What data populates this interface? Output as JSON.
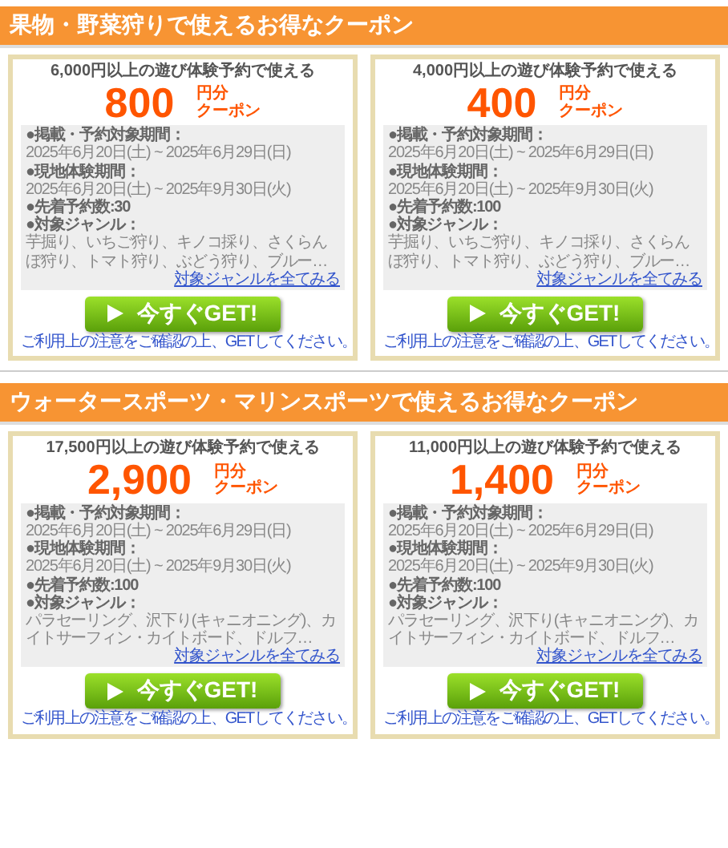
{
  "sections": [
    {
      "title": "果物・野菜狩りで使えるお得なクーポン",
      "coupons": [
        {
          "condition": "6,000円以上の遊び体験予約で使える",
          "amount": "800",
          "unit": [
            "円分",
            "クーポン"
          ],
          "details": [
            {
              "kind": "heading",
              "text": "●掲載・予約対象期間："
            },
            {
              "kind": "text",
              "text": "2025年6月20日(土) ~ 2025年6月29日(日)"
            },
            {
              "kind": "heading",
              "text": "●現地体験期間："
            },
            {
              "kind": "text",
              "text": "2025年6月20日(土) ~ 2025年9月30日(火)"
            },
            {
              "kind": "heading",
              "text": "●先着予約数:30"
            },
            {
              "kind": "heading",
              "text": "●対象ジャンル："
            },
            {
              "kind": "text",
              "text": "芋掘り、いちご狩り、キノコ採り、さくらんぼ狩り、トマト狩り、ぶどう狩り、ブルー…"
            }
          ],
          "link": "対象ジャンルを全てみる",
          "button": "今すぐGET!",
          "note": "ご利用上の注意をご確認の上、GETしてください。"
        },
        {
          "condition": "4,000円以上の遊び体験予約で使える",
          "amount": "400",
          "unit": [
            "円分",
            "クーポン"
          ],
          "details": [
            {
              "kind": "heading",
              "text": "●掲載・予約対象期間："
            },
            {
              "kind": "text",
              "text": "2025年6月20日(土) ~ 2025年6月29日(日)"
            },
            {
              "kind": "heading",
              "text": "●現地体験期間："
            },
            {
              "kind": "text",
              "text": "2025年6月20日(土) ~ 2025年9月30日(火)"
            },
            {
              "kind": "heading",
              "text": "●先着予約数:100"
            },
            {
              "kind": "heading",
              "text": "●対象ジャンル："
            },
            {
              "kind": "text",
              "text": "芋掘り、いちご狩り、キノコ採り、さくらんぼ狩り、トマト狩り、ぶどう狩り、ブルー…"
            }
          ],
          "link": "対象ジャンルを全てみる",
          "button": "今すぐGET!",
          "note": "ご利用上の注意をご確認の上、GETしてください。"
        }
      ]
    },
    {
      "title": "ウォータースポーツ・マリンスポーツで使えるお得なクーポン",
      "coupons": [
        {
          "condition": "17,500円以上の遊び体験予約で使える",
          "amount": "2,900",
          "unit": [
            "円分",
            "クーポン"
          ],
          "details": [
            {
              "kind": "heading",
              "text": "●掲載・予約対象期間："
            },
            {
              "kind": "text",
              "text": "2025年6月20日(土) ~ 2025年6月29日(日)"
            },
            {
              "kind": "heading",
              "text": "●現地体験期間："
            },
            {
              "kind": "text",
              "text": "2025年6月20日(土) ~ 2025年9月30日(火)"
            },
            {
              "kind": "heading",
              "text": "●先着予約数:100"
            },
            {
              "kind": "heading",
              "text": "●対象ジャンル："
            },
            {
              "kind": "text",
              "text": "パラセーリング、沢下り(キャニオニング)、カイトサーフィン・カイトボード、ドルフ…"
            }
          ],
          "link": "対象ジャンルを全てみる",
          "button": "今すぐGET!",
          "note": "ご利用上の注意をご確認の上、GETしてください。"
        },
        {
          "condition": "11,000円以上の遊び体験予約で使える",
          "amount": "1,400",
          "unit": [
            "円分",
            "クーポン"
          ],
          "details": [
            {
              "kind": "heading",
              "text": "●掲載・予約対象期間："
            },
            {
              "kind": "text",
              "text": "2025年6月20日(土) ~ 2025年6月29日(日)"
            },
            {
              "kind": "heading",
              "text": "●現地体験期間："
            },
            {
              "kind": "text",
              "text": "2025年6月20日(土) ~ 2025年9月30日(火)"
            },
            {
              "kind": "heading",
              "text": "●先着予約数:100"
            },
            {
              "kind": "heading",
              "text": "●対象ジャンル："
            },
            {
              "kind": "text",
              "text": "パラセーリング、沢下り(キャニオニング)、カイトサーフィン・カイトボード、ドルフ…"
            }
          ],
          "link": "対象ジャンルを全てみる",
          "button": "今すぐGET!",
          "note": "ご利用上の注意をご確認の上、GETしてください。"
        }
      ]
    }
  ]
}
